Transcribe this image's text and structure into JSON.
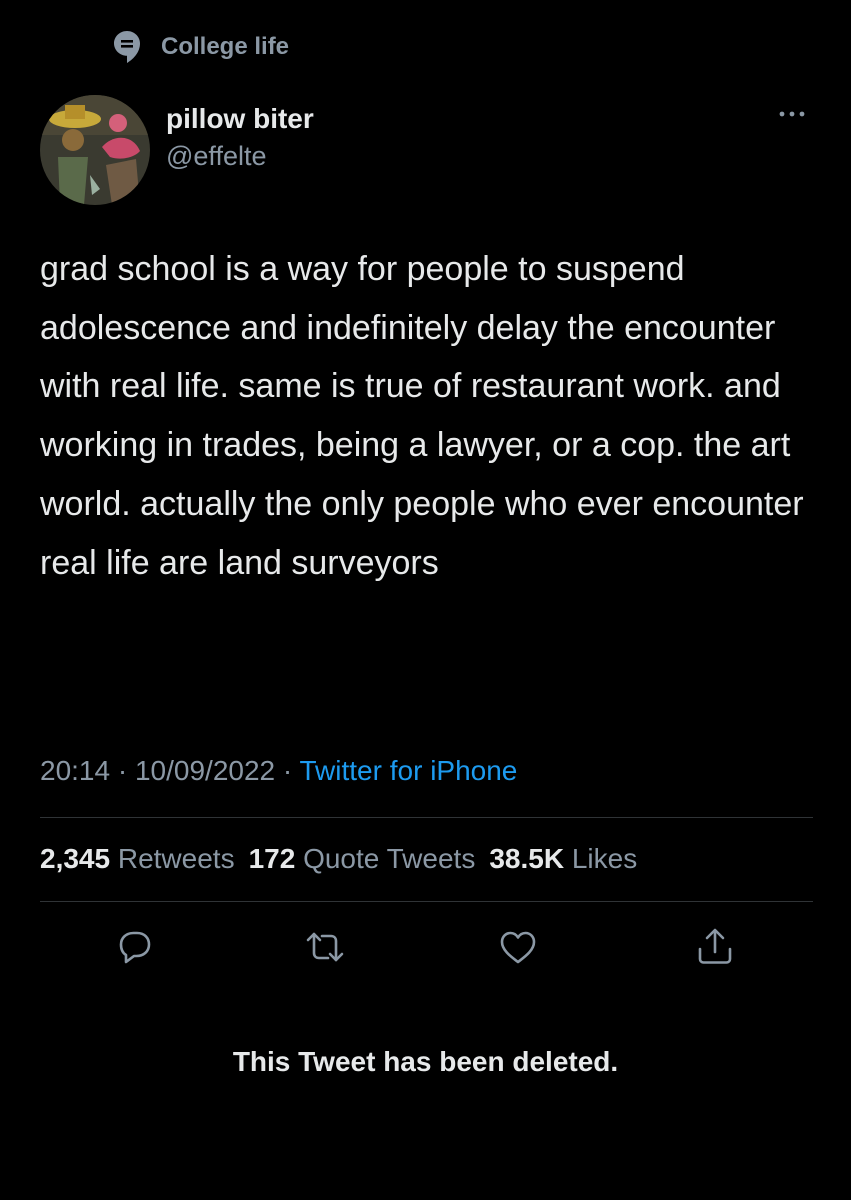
{
  "context": {
    "icon": "community-icon",
    "label": "College life"
  },
  "author": {
    "avatar": "avatar",
    "display_name": "pillow biter",
    "handle": "@effelte"
  },
  "tweet": {
    "text": "grad school is a way for people to suspend adolescence and indefinitely delay the encounter with real life. same is true of restaurant work. and working in trades, being a lawyer, or a cop. the art world. actually the only people who ever encounter real life are land surveyors",
    "time": "20:14",
    "separator": " · ",
    "date": "10/09/2022",
    "source": "Twitter for iPhone"
  },
  "stats": {
    "retweets_count": "2,345",
    "retweets_label": "Retweets",
    "quotes_count": "172",
    "quotes_label": "Quote Tweets",
    "likes_count": "38.5K",
    "likes_label": "Likes"
  },
  "actions": [
    "reply-icon",
    "retweet-icon",
    "like-icon",
    "share-icon"
  ],
  "notice": {
    "deleted": "This Tweet has been deleted."
  },
  "colors": {
    "background": "#000000",
    "text_primary": "#e7e9ea",
    "text_secondary": "#8b98a5",
    "link": "#1d9bf0",
    "divider": "#2f3336"
  }
}
